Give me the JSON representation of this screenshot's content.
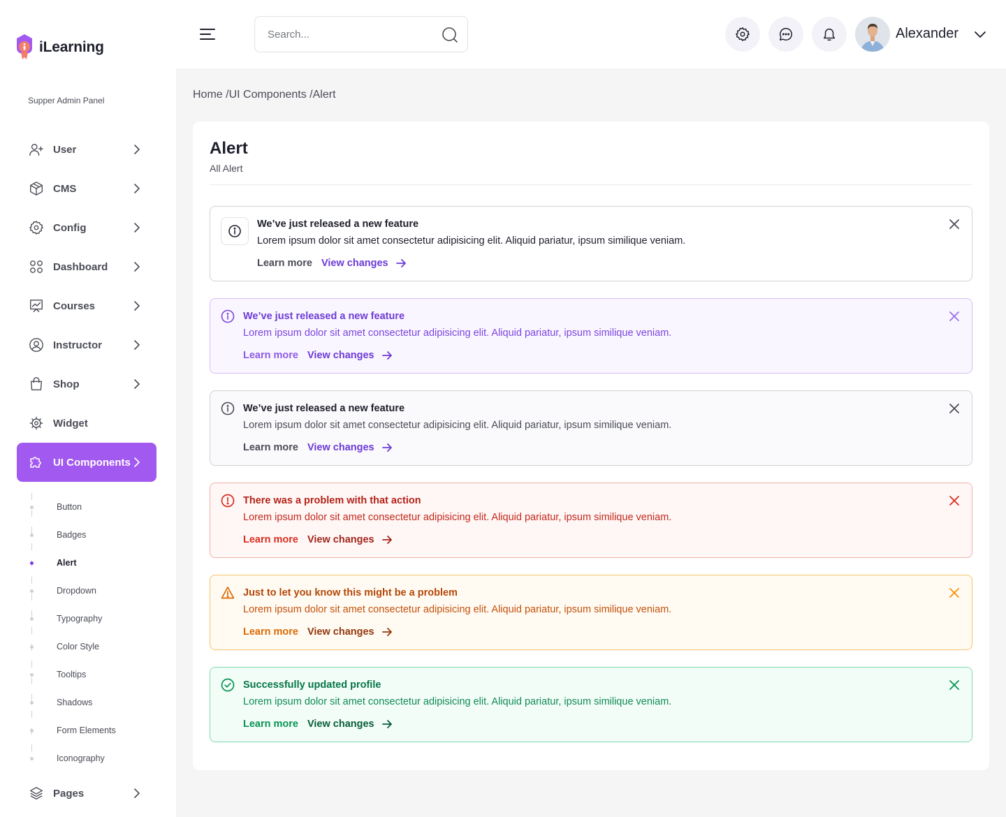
{
  "app": {
    "name": "iLearning",
    "panel_label": "Supper Admin Panel"
  },
  "colors": {
    "accent": "#a259f0",
    "primary_text": "#1d1f2c",
    "secondary_text": "#4a4c56"
  },
  "search": {
    "placeholder": "Search..."
  },
  "user": {
    "name": "Alexander"
  },
  "sidebar": {
    "items": [
      {
        "label": "User",
        "icon": "user-plus-icon"
      },
      {
        "label": "CMS",
        "icon": "box-icon"
      },
      {
        "label": "Config",
        "icon": "gear-icon"
      },
      {
        "label": "Dashboard",
        "icon": "grid-icon"
      },
      {
        "label": "Courses",
        "icon": "presentation-icon"
      },
      {
        "label": "Instructor",
        "icon": "user-circle-icon"
      },
      {
        "label": "Shop",
        "icon": "shopping-bag-icon"
      },
      {
        "label": "Widget",
        "icon": "cog-icon"
      },
      {
        "label": "UI Components",
        "icon": "puzzle-icon"
      }
    ],
    "sub_items": [
      "Button",
      "Badges",
      "Alert",
      "Dropdown",
      "Typography",
      "Color Style",
      "Tooltips",
      "Shadows",
      "Form Elements",
      "Iconography"
    ],
    "active_sub": "Alert",
    "bottom_item": {
      "label": "Pages",
      "icon": "layers-icon"
    }
  },
  "breadcrumb": "Home /UI Components /Alert",
  "card": {
    "title": "Alert",
    "subtitle": "All Alert"
  },
  "alerts": [
    {
      "title": "We’ve just released a new feature",
      "body": "Lorem ipsum dolor sit amet consectetur adipisicing elit. Aliquid pariatur, ipsum similique veniam.",
      "learn_more": "Learn more",
      "view_changes": "View changes",
      "variant": "default"
    },
    {
      "title": "We’ve just released a new feature",
      "body": "Lorem ipsum dolor sit amet consectetur adipisicing elit. Aliquid pariatur, ipsum similique veniam.",
      "learn_more": "Learn more",
      "view_changes": "View changes",
      "variant": "primary"
    },
    {
      "title": "We’ve just released a new feature",
      "body": "Lorem ipsum dolor sit amet consectetur adipisicing elit. Aliquid pariatur, ipsum similique veniam.",
      "learn_more": "Learn more",
      "view_changes": "View changes",
      "variant": "gray"
    },
    {
      "title": "There was a problem with that action",
      "body": "Lorem ipsum dolor sit amet consectetur adipisicing elit. Aliquid pariatur, ipsum similique veniam.",
      "learn_more": "Learn more",
      "view_changes": "View changes",
      "variant": "error"
    },
    {
      "title": "Just to let you know this might be a problem",
      "body": "Lorem ipsum dolor sit amet consectetur adipisicing elit. Aliquid pariatur, ipsum similique veniam.",
      "learn_more": "Learn more",
      "view_changes": "View changes",
      "variant": "warning"
    },
    {
      "title": "Successfully updated profile",
      "body": "Lorem ipsum dolor sit amet consectetur adipisicing elit. Aliquid pariatur, ipsum similique veniam.",
      "learn_more": "Learn more",
      "view_changes": "View changes",
      "variant": "success"
    }
  ]
}
